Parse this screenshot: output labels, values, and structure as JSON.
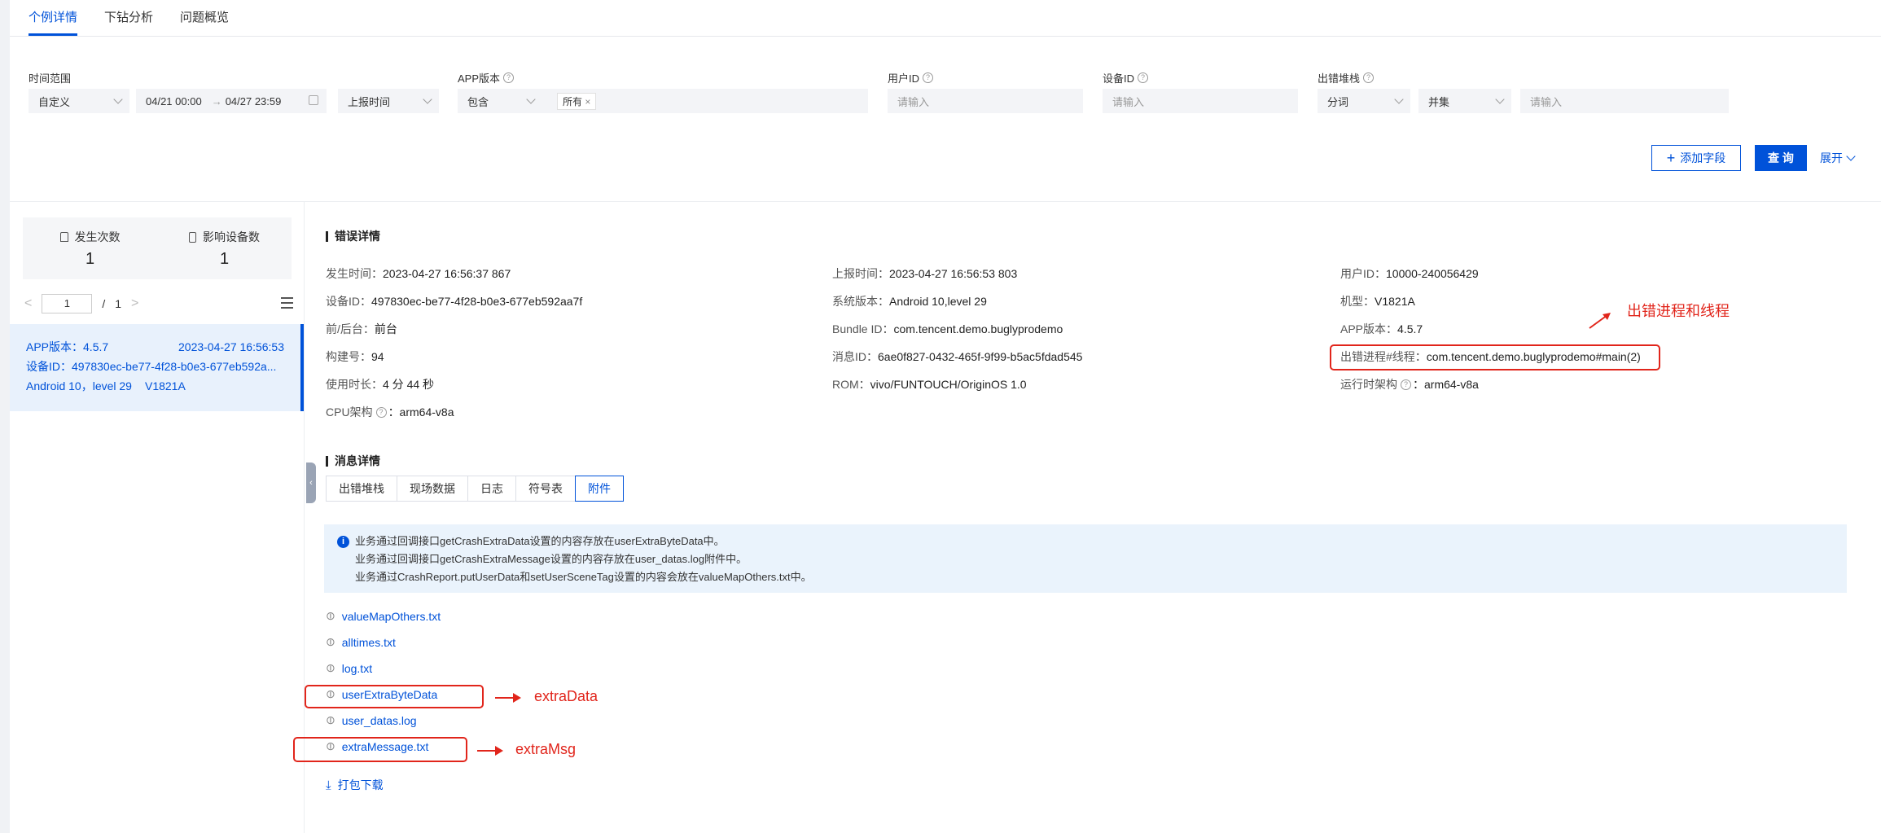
{
  "tabs": [
    {
      "label": "个例详情",
      "active": true
    },
    {
      "label": "下钻分析",
      "active": false
    },
    {
      "label": "问题概览",
      "active": false
    }
  ],
  "filters": {
    "time_range": {
      "label": "时间范围",
      "mode": "自定义",
      "start": "04/21 00:00",
      "sep": "→",
      "end": "04/27 23:59",
      "time_type": "上报时间"
    },
    "app_version": {
      "label": "APP版本",
      "op": "包含",
      "tag": "所有",
      "tag_close": "×"
    },
    "user_id": {
      "label": "用户ID",
      "placeholder": "请输入"
    },
    "device_id": {
      "label": "设备ID",
      "placeholder": "请输入"
    },
    "stack": {
      "label": "出错堆栈",
      "op1": "分词",
      "op2": "并集",
      "placeholder": "请输入"
    }
  },
  "actions": {
    "add_field": "添加字段",
    "add_plus": "+",
    "query": "查 询",
    "expand": "展开"
  },
  "left": {
    "stats": [
      {
        "label": "发生次数",
        "value": "1"
      },
      {
        "label": "影响设备数",
        "value": "1"
      }
    ],
    "pager": {
      "prev": "<",
      "page": "1",
      "sep": "/",
      "total": "1",
      "next": ">"
    },
    "item": {
      "version": "APP版本：4.5.7",
      "time": "2023-04-27 16:56:53",
      "device": "设备ID：497830ec-be77-4f28-b0e3-677eb592a...",
      "os": "Android 10，level 29",
      "model": "V1821A"
    },
    "collapse_icon": "‹"
  },
  "error_detail": {
    "title": "错误详情",
    "col1": [
      {
        "k": "发生时间：",
        "v": "2023-04-27 16:56:37 867"
      },
      {
        "k": "设备ID：",
        "v": "497830ec-be77-4f28-b0e3-677eb592aa7f"
      },
      {
        "k": "前/后台：",
        "v": "前台"
      },
      {
        "k": "构建号：",
        "v": "94"
      },
      {
        "k": "使用时长：",
        "v": "4 分 44 秒"
      },
      {
        "k": "CPU架构",
        "v": "：arm64-v8a"
      }
    ],
    "col2": [
      {
        "k": "上报时间：",
        "v": "2023-04-27 16:56:53 803"
      },
      {
        "k": "系统版本：",
        "v": "Android 10,level 29"
      },
      {
        "k": "Bundle ID：",
        "v": "com.tencent.demo.buglyprodemo"
      },
      {
        "k": "消息ID：",
        "v": "6ae0f827-0432-465f-9f99-b5ac5fdad545"
      },
      {
        "k": "ROM：",
        "v": "vivo/FUNTOUCH/OriginOS 1.0"
      }
    ],
    "col3": [
      {
        "k": "用户ID：",
        "v": "10000-240056429"
      },
      {
        "k": "机型：",
        "v": "V1821A"
      },
      {
        "k": "APP版本：",
        "v": "4.5.7"
      },
      {
        "k": "出错进程#线程：",
        "v": "com.tencent.demo.buglyprodemo#main(2)"
      },
      {
        "k": "运行时架构",
        "v": "：arm64-v8a"
      }
    ]
  },
  "message_detail": {
    "title": "消息详情",
    "tabs": [
      {
        "label": "出错堆栈",
        "active": false
      },
      {
        "label": "现场数据",
        "active": false
      },
      {
        "label": "日志",
        "active": false
      },
      {
        "label": "符号表",
        "active": false
      },
      {
        "label": "附件",
        "active": true
      }
    ],
    "info_icon": "i",
    "info_lines": [
      "业务通过回调接口getCrashExtraData设置的内容存放在userExtraByteData中。",
      "业务通过回调接口getCrashExtraMessage设置的内容存放在user_datas.log附件中。",
      "业务通过CrashReport.putUserData和setUserSceneTag设置的内容会放在valueMapOthers.txt中。"
    ],
    "files": [
      "valueMapOthers.txt",
      "alltimes.txt",
      "log.txt",
      "userExtraByteData",
      "user_datas.log",
      "extraMessage.txt"
    ],
    "download": "打包下载"
  },
  "annotations": {
    "thread": "出错进程和线程",
    "extra_data": "extraData",
    "extra_msg": "extraMsg"
  },
  "colors": {
    "accent": "#0052d9",
    "annotation": "#e1251b",
    "selected_bg": "#e8f1fc"
  }
}
